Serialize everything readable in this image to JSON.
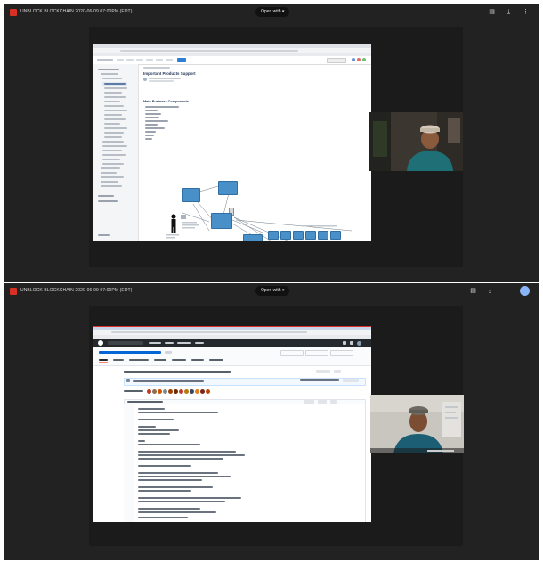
{
  "panels": [
    {
      "title": "UNBLOCK BLOCKCHAIN 2020-06-09 07:00PM (EDT)",
      "open_with": "Open with",
      "screen": {
        "page_heading": "Important Products Support",
        "section_heading": "Main Business Components"
      }
    },
    {
      "title": "UNBLOCK BLOCKCHAIN 2020-06-09 07:00PM (EDT)",
      "open_with": "Open with",
      "screen": {}
    }
  ],
  "icons": [
    "comment-icon",
    "download-icon",
    "more-vert-icon",
    "account-avatar-icon"
  ],
  "colors": {
    "panel_bg": "#222222",
    "record_red": "#d93025",
    "diagram_blue": "#4a90c8",
    "github_dark": "#24292e"
  }
}
